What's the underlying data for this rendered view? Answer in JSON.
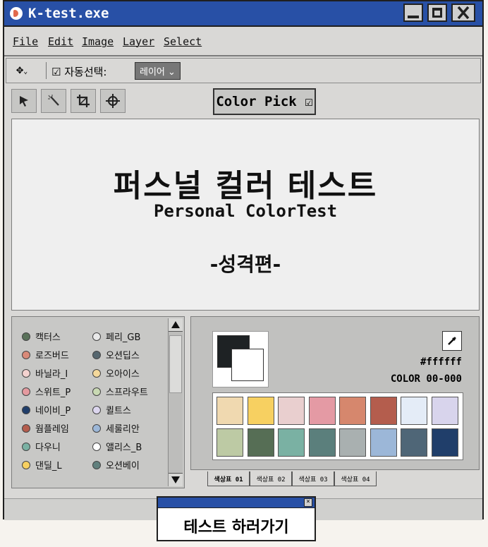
{
  "window": {
    "title": "K-test.exe"
  },
  "menu": [
    "File",
    "Edit",
    "Image",
    "Layer",
    "Select"
  ],
  "toolbar": {
    "auto_select_label": "☑ 자동선택:",
    "layer_select": "레이어"
  },
  "tools": [
    "arrow",
    "magic-wand",
    "crop",
    "crosshair"
  ],
  "color_pick": {
    "label": "Color Pick ☑"
  },
  "canvas": {
    "title_kr": "퍼스널 컬러 테스트",
    "title_en": "Personal ColorTest",
    "subtitle": "-성격편-"
  },
  "palette_list": [
    {
      "label": "캑터스",
      "color": "#5a725a"
    },
    {
      "label": "페리_GB",
      "color": "#e9e9e9"
    },
    {
      "label": "로즈버드",
      "color": "#d98a79"
    },
    {
      "label": "오션딥스",
      "color": "#56676f"
    },
    {
      "label": "바닐라_I",
      "color": "#f3d2cf"
    },
    {
      "label": "오아이스",
      "color": "#f4d89b"
    },
    {
      "label": "스위트_P",
      "color": "#e49a9f"
    },
    {
      "label": "스프라우트",
      "color": "#c9d9b3"
    },
    {
      "label": "네이비_P",
      "color": "#203e6a"
    },
    {
      "label": "퀼트스",
      "color": "#dcd6ee"
    },
    {
      "label": "웜플레임",
      "color": "#b45d4d"
    },
    {
      "label": "세룰리안",
      "color": "#9cb7d8"
    },
    {
      "label": "다우니",
      "color": "#7ab1a3"
    },
    {
      "label": "앨리스_B",
      "color": "#ffffff"
    },
    {
      "label": "댄딜_L",
      "color": "#f7d061"
    },
    {
      "label": "오션베이",
      "color": "#61807d"
    }
  ],
  "color_panel": {
    "hex": "#ffffff",
    "code": "COLOR 00-000",
    "swatches": [
      "#f0d9b0",
      "#f7d061",
      "#e9cfcf",
      "#e49aa4",
      "#d6876d",
      "#b45d4d",
      "#e4ecf7",
      "#d8d4ec",
      "#bdcaa4",
      "#566e55",
      "#7ab1a3",
      "#5b7f7c",
      "#a9b0b0",
      "#9cb7d8",
      "#4f6677",
      "#203e6a"
    ]
  },
  "tabs": [
    "색상표 01",
    "색상표 02",
    "색상표 03",
    "색상표 04"
  ],
  "dialog": {
    "button": "테스트 하러가기"
  }
}
